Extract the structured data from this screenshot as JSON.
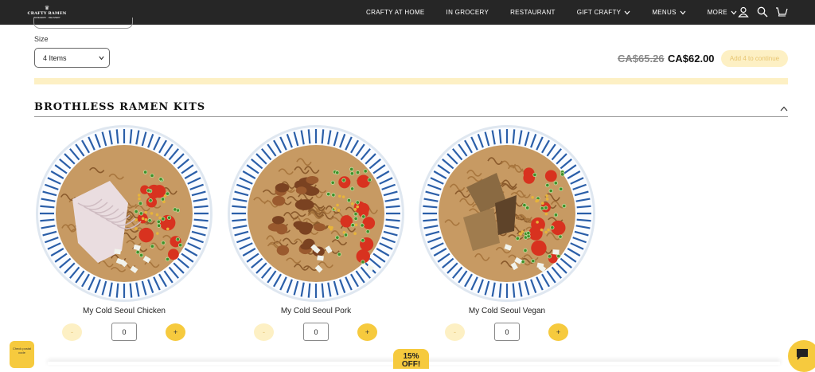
{
  "header": {
    "logo_text": "CRAFTY RAMEN",
    "logo_sub": "TAKEAWAY · DELIVERY",
    "nav": [
      {
        "label": "CRAFTY AT HOME",
        "has_dropdown": false
      },
      {
        "label": "IN GROCERY",
        "has_dropdown": false
      },
      {
        "label": "RESTAURANT",
        "has_dropdown": false
      },
      {
        "label": "GIFT CRAFTY",
        "has_dropdown": true
      },
      {
        "label": "MENUS",
        "has_dropdown": true
      },
      {
        "label": "MORE",
        "has_dropdown": true
      }
    ],
    "icons": [
      "account-icon",
      "search-icon",
      "cart-icon"
    ]
  },
  "size": {
    "label": "Size",
    "selected": "4 Items"
  },
  "pricing": {
    "old_price": "CA$65.26",
    "new_price": "CA$62.00",
    "continue_label": "Add 4 to continue"
  },
  "section": {
    "title": "BROTHLESS RAMEN KITS",
    "expanded": true
  },
  "products": [
    {
      "name": "My Cold Seoul Chicken",
      "quantity": "0",
      "minus": "-",
      "plus": "+",
      "topping": "chicken"
    },
    {
      "name": "My Cold Seoul Pork",
      "quantity": "0",
      "minus": "-",
      "plus": "+",
      "topping": "pork"
    },
    {
      "name": "My Cold Seoul Vegan",
      "quantity": "0",
      "minus": "-",
      "plus": "+",
      "topping": "vegan"
    }
  ],
  "widgets": {
    "postal_label": "Check postal code",
    "discount_label": "15% OFF!"
  },
  "colors": {
    "header_bg": "#262626",
    "accent_yellow": "#f6ca3e",
    "pale_yellow": "#fdf0c4",
    "bowl_blue": "#2a5ea8"
  }
}
